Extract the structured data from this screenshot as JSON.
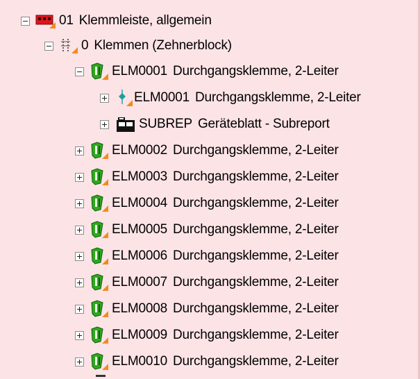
{
  "tree": {
    "root": {
      "code": "01",
      "text": "Klemmleiste, allgemein",
      "expanded": true,
      "icon": "terminal-strip-icon"
    },
    "block": {
      "code": "0",
      "text": "Klemmen (Zehnerblock)",
      "expanded": true,
      "icon": "terminal-block-icon"
    },
    "terminals": [
      {
        "code": "ELM0001",
        "text": "Durchgangsklemme, 2-Leiter",
        "expanded": true,
        "icon": "terminal-icon"
      },
      {
        "code": "ELM0002",
        "text": "Durchgangsklemme, 2-Leiter",
        "expanded": false,
        "icon": "terminal-icon"
      },
      {
        "code": "ELM0003",
        "text": "Durchgangsklemme, 2-Leiter",
        "expanded": false,
        "icon": "terminal-icon"
      },
      {
        "code": "ELM0004",
        "text": "Durchgangsklemme, 2-Leiter",
        "expanded": false,
        "icon": "terminal-icon"
      },
      {
        "code": "ELM0005",
        "text": "Durchgangsklemme, 2-Leiter",
        "expanded": false,
        "icon": "terminal-icon"
      },
      {
        "code": "ELM0006",
        "text": "Durchgangsklemme, 2-Leiter",
        "expanded": false,
        "icon": "terminal-icon"
      },
      {
        "code": "ELM0007",
        "text": "Durchgangsklemme, 2-Leiter",
        "expanded": false,
        "icon": "terminal-icon"
      },
      {
        "code": "ELM0008",
        "text": "Durchgangsklemme, 2-Leiter",
        "expanded": false,
        "icon": "terminal-icon"
      },
      {
        "code": "ELM0009",
        "text": "Durchgangsklemme, 2-Leiter",
        "expanded": false,
        "icon": "terminal-icon"
      },
      {
        "code": "ELM0010",
        "text": "Durchgangsklemme, 2-Leiter",
        "expanded": false,
        "icon": "terminal-icon"
      }
    ],
    "children_of_first": [
      {
        "code": "ELM0001",
        "text": "Durchgangsklemme, 2-Leiter",
        "expanded": false,
        "icon": "connection-point-icon"
      },
      {
        "code": "SUBREP",
        "text": "Geräteblatt - Subreport",
        "expanded": false,
        "icon": "subreport-icon"
      }
    ]
  },
  "colors": {
    "background": "#fce3e6",
    "accent_orange": "#f28a1c",
    "terminal_green": "#2fa81e",
    "strip_red": "#d9161c"
  }
}
